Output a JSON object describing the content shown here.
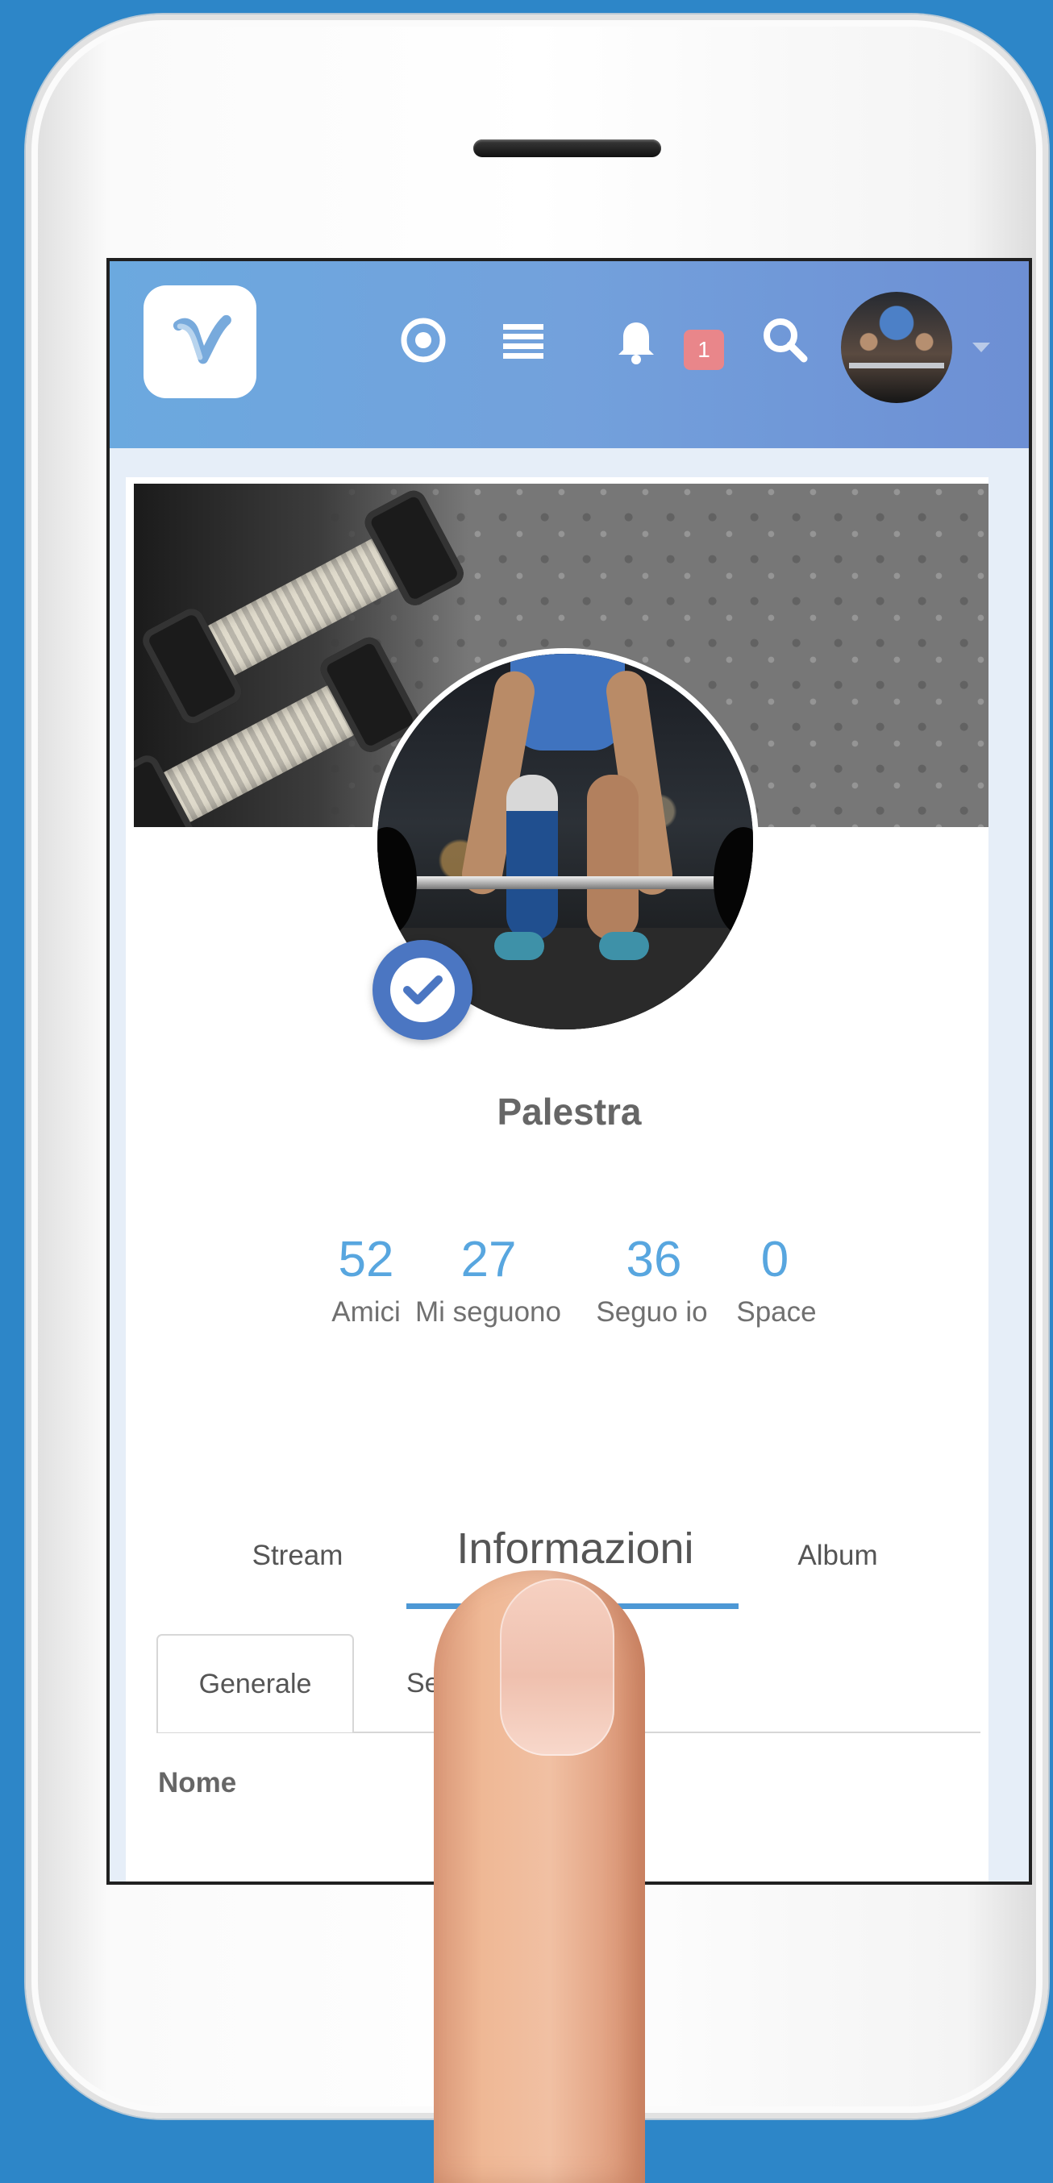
{
  "app": {
    "name": "",
    "accent": "#58a6df",
    "brand": "#6d9ed9"
  },
  "topbar": {
    "logo_letter": "V",
    "notifications_count": "1",
    "icons": [
      "logo",
      "target-icon",
      "menu-icon",
      "bell-icon",
      "search-icon",
      "avatar",
      "chevron-down-icon"
    ]
  },
  "profile": {
    "name": "Palestra",
    "verified_icon": "check-circle-icon",
    "stats": [
      {
        "value": "52",
        "label": "Amici"
      },
      {
        "value": "27",
        "label": "Mi seguono"
      },
      {
        "value": "36",
        "label": "Seguo io"
      },
      {
        "value": "0",
        "label": "Space"
      }
    ]
  },
  "tabs": {
    "items": [
      "Stream",
      "Informazioni",
      "Album"
    ],
    "active": "Informazioni"
  },
  "subtabs": {
    "items": [
      "Generale",
      "Seg"
    ],
    "active": "Generale"
  },
  "fields": {
    "name_label": "Nome"
  }
}
